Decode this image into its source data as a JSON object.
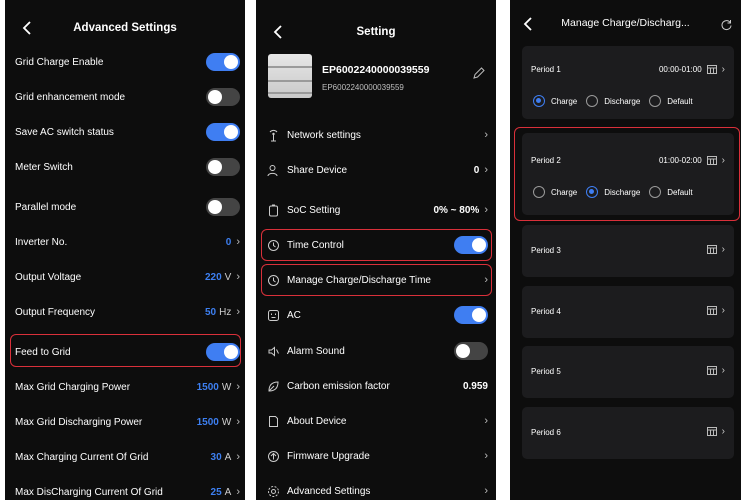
{
  "colors": {
    "accent": "#3f7ef2",
    "highlight": "#d9303a",
    "background": "#0d0d0d",
    "card": "#1c1c1e"
  },
  "screen1": {
    "title": "Advanced Settings",
    "rows": [
      {
        "label": "Grid Charge Enable",
        "kind": "toggle",
        "on": true
      },
      {
        "label": "Grid enhancement mode",
        "kind": "toggle",
        "on": false
      },
      {
        "label": "Save AC switch status",
        "kind": "toggle",
        "on": true
      },
      {
        "label": "Meter Switch",
        "kind": "toggle",
        "on": false
      },
      {
        "label": "Parallel mode",
        "kind": "toggle",
        "on": false
      },
      {
        "label": "Inverter No.",
        "kind": "value",
        "value": "0",
        "unit": ""
      },
      {
        "label": "Output Voltage",
        "kind": "value",
        "value": "220",
        "unit": "V"
      },
      {
        "label": "Output Frequency",
        "kind": "value",
        "value": "50",
        "unit": "Hz"
      },
      {
        "label": "Feed to Grid",
        "kind": "toggle",
        "on": true
      },
      {
        "label": "Max Grid Charging Power",
        "kind": "value",
        "value": "1500",
        "unit": "W"
      },
      {
        "label": "Max Grid Discharging Power",
        "kind": "value",
        "value": "1500",
        "unit": "W"
      },
      {
        "label": "Max Charging Current Of Grid",
        "kind": "value",
        "value": "30",
        "unit": "A"
      },
      {
        "label": "Max DisCharging Current Of Grid",
        "kind": "value",
        "value": "25",
        "unit": "A"
      }
    ]
  },
  "screen2": {
    "title": "Setting",
    "device": {
      "name": "EP6002240000039559",
      "serial": "EP6002240000039559"
    },
    "rows": [
      {
        "label": "Network settings",
        "icon": "wifi-antenna-icon",
        "kind": "chevron"
      },
      {
        "label": "Share Device",
        "icon": "user-share-icon",
        "kind": "value",
        "value": "0"
      },
      {
        "label": "SoC Setting",
        "icon": "battery-icon",
        "kind": "value",
        "value": "0% ~ 80%"
      },
      {
        "label": "Time Control",
        "icon": "clock-icon",
        "kind": "toggle",
        "on": true
      },
      {
        "label": "Manage Charge/Discharge Time",
        "icon": "clock-icon",
        "kind": "chevron"
      },
      {
        "label": "AC",
        "icon": "ac-outlet-icon",
        "kind": "toggle",
        "on": true
      },
      {
        "label": "Alarm Sound",
        "icon": "speaker-icon",
        "kind": "toggle",
        "on": false
      },
      {
        "label": "Carbon emission factor",
        "icon": "leaf-icon",
        "kind": "value",
        "value": "0.959"
      },
      {
        "label": "About Device",
        "icon": "document-icon",
        "kind": "chevron"
      },
      {
        "label": "Firmware Upgrade",
        "icon": "upgrade-icon",
        "kind": "chevron"
      },
      {
        "label": "Advanced Settings",
        "icon": "gear-icon",
        "kind": "chevron"
      }
    ]
  },
  "screen3": {
    "title": "Manage Charge/Discharg...",
    "mode_labels": {
      "charge": "Charge",
      "discharge": "Discharge",
      "default": "Default"
    },
    "periods": [
      {
        "name": "Period 1",
        "time": "00:00-01:00",
        "mode": "charge"
      },
      {
        "name": "Period 2",
        "time": "01:00-02:00",
        "mode": "discharge"
      },
      {
        "name": "Period 3",
        "time": ""
      },
      {
        "name": "Period 4",
        "time": ""
      },
      {
        "name": "Period 5",
        "time": ""
      },
      {
        "name": "Period 6",
        "time": ""
      }
    ]
  }
}
